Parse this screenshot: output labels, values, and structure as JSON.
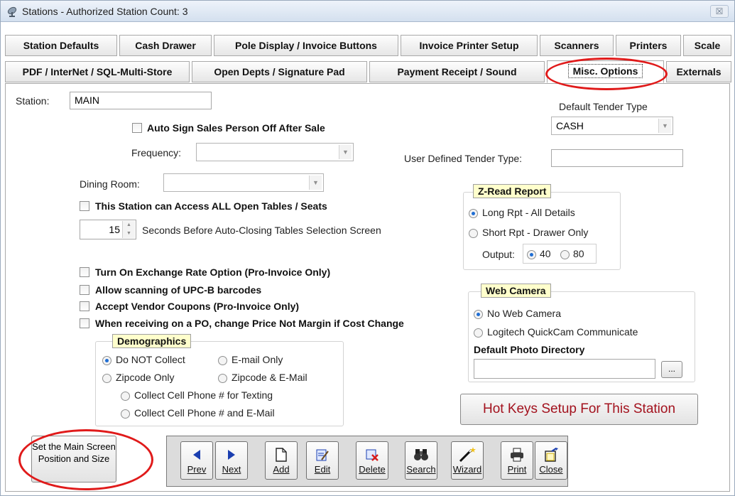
{
  "window": {
    "title": "Stations - Authorized Station Count: 3",
    "close_glyph": "☒"
  },
  "tabs_row1": [
    "Station Defaults",
    "Cash Drawer",
    "Pole Display / Invoice Buttons",
    "Invoice Printer Setup",
    "Scanners",
    "Printers",
    "Scale"
  ],
  "tabs_row2": [
    "PDF / InterNet / SQL-Multi-Store",
    "Open Depts / Signature Pad",
    "Payment Receipt / Sound",
    "Misc. Options",
    "Externals"
  ],
  "station": {
    "label": "Station:",
    "value": "MAIN"
  },
  "auto_sign_off": {
    "label": "Auto Sign Sales Person Off After Sale",
    "checked": false
  },
  "frequency": {
    "label": "Frequency:",
    "value": ""
  },
  "dining_room": {
    "label": "Dining Room:",
    "value": ""
  },
  "access_all_tables": {
    "label": "This Station can Access ALL Open Tables / Seats",
    "checked": false
  },
  "auto_close": {
    "value": "15",
    "label": "Seconds Before Auto-Closing Tables Selection Screen"
  },
  "options": [
    "Turn On Exchange Rate Option (Pro-Invoice Only)",
    "Allow scanning of UPC-B barcodes",
    "Accept Vendor Coupons (Pro-Invoice Only)",
    "When receiving on a PO, change Price Not Margin if Cost Change"
  ],
  "demographics": {
    "legend": "Demographics",
    "do_not_collect": "Do NOT Collect",
    "email_only": "E-mail Only",
    "zipcode_only": "Zipcode Only",
    "zipcode_email": "Zipcode & E-Mail",
    "cell_texting": "Collect Cell Phone # for Texting",
    "cell_email": "Collect Cell Phone # and E-Mail",
    "selected": "do_not_collect"
  },
  "default_tender": {
    "label": "Default Tender Type",
    "value": "CASH"
  },
  "user_tender": {
    "label": "User Defined Tender Type:",
    "value": ""
  },
  "zread": {
    "legend": "Z-Read Report",
    "long": "Long Rpt - All Details",
    "short": "Short Rpt - Drawer Only",
    "output_label": "Output:",
    "opt40": "40",
    "opt80": "80",
    "selected": "long",
    "output_selected": "40"
  },
  "web_camera": {
    "legend": "Web Camera",
    "none": "No Web Camera",
    "logitech": "Logitech QuickCam Communicate",
    "dir_label": "Default Photo Directory",
    "dir_value": "",
    "browse": "...",
    "selected": "none"
  },
  "hotkeys_button": "Hot Keys Setup For This Station",
  "main_screen_button": "Set the Main Screen Position and Size",
  "nav": [
    "Prev",
    "Next",
    "Add",
    "Edit",
    "Delete",
    "Search",
    "Wizard",
    "Print",
    "Close"
  ],
  "colors": {
    "accent": "#1f6ed4",
    "legend_bg": "#ffffcc",
    "annotation": "#e01a1a",
    "hotkey_text": "#a3121e"
  }
}
